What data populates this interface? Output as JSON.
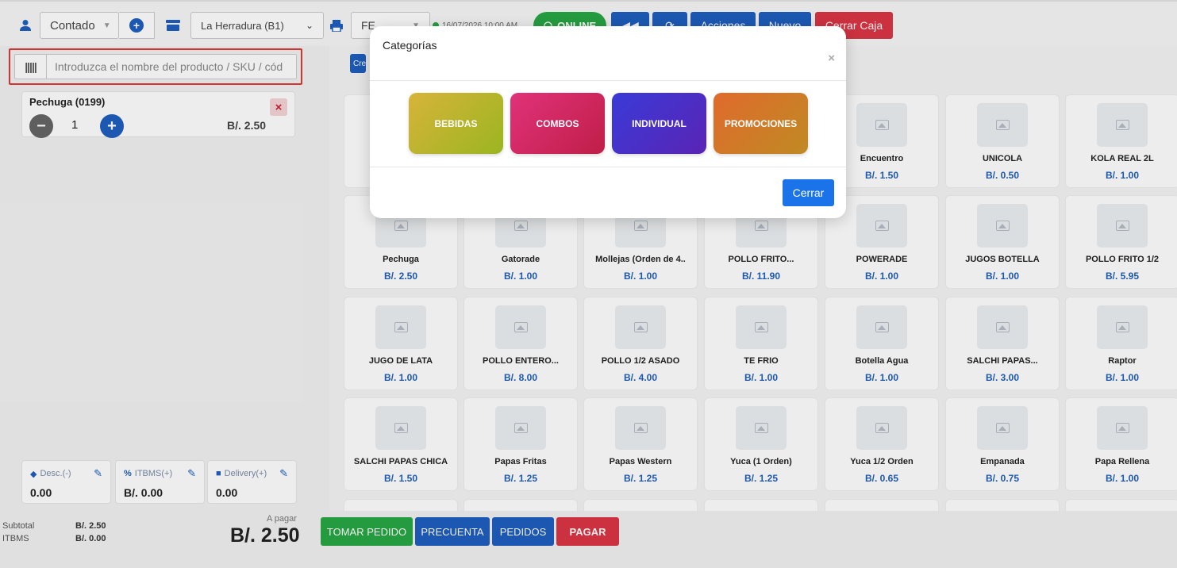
{
  "topbar": {
    "client_select": "Contado",
    "store_select": "La Herradura (B1)",
    "doc_select": "FE",
    "datetime": "16/07/2026 10:00 AM",
    "online": "ONLINE",
    "acciones": "Acciones",
    "nuevo": "Nuevo",
    "cerrar_caja": "Cerrar Caja"
  },
  "search": {
    "placeholder": "Introduzca el nombre del producto / SKU / cód"
  },
  "cart": {
    "items": [
      {
        "name": "Pechuga (0199)",
        "qty": "1",
        "price": "B/. 2.50"
      }
    ]
  },
  "adjustments": {
    "desc_label": "Desc.(-)",
    "desc_value": "0.00",
    "itbms_label": "ITBMS(+)",
    "itbms_value": "B/. 0.00",
    "delivery_label": "Delivery(+)",
    "delivery_value": "0.00"
  },
  "totals": {
    "subtotal_label": "Subtotal",
    "subtotal_value": "B/. 2.50",
    "itbms_label": "ITBMS",
    "itbms_value": "B/. 0.00",
    "apagar_label": "A pagar",
    "apagar_value": "B/. 2.50"
  },
  "bottom": {
    "tomar_pedido": "TOMAR PEDIDO",
    "precuenta": "PRECUENTA",
    "pedidos": "PEDIDOS",
    "pagar": "PAGAR"
  },
  "grid": {
    "categories_btn": "Cre",
    "products": [
      {
        "name": "Encuentro",
        "price": "B/. 1.50"
      },
      {
        "name": "UNICOLA",
        "price": "B/. 0.50"
      },
      {
        "name": "KOLA REAL 2L",
        "price": "B/. 1.00"
      },
      {
        "name": "Pechuga",
        "price": "B/. 2.50"
      },
      {
        "name": "Gatorade",
        "price": "B/. 1.00"
      },
      {
        "name": "Mollejas (Orden de 4..",
        "price": "B/. 1.00"
      },
      {
        "name": "POLLO FRITO...",
        "price": "B/. 11.90"
      },
      {
        "name": "POWERADE",
        "price": "B/. 1.00"
      },
      {
        "name": "JUGOS BOTELLA",
        "price": "B/. 1.00"
      },
      {
        "name": "POLLO FRITO 1/2",
        "price": "B/. 5.95"
      },
      {
        "name": "JUGO DE LATA",
        "price": "B/. 1.00"
      },
      {
        "name": "POLLO ENTERO...",
        "price": "B/. 8.00"
      },
      {
        "name": "POLLO 1/2 ASADO",
        "price": "B/. 4.00"
      },
      {
        "name": "TE FRIO",
        "price": "B/. 1.00"
      },
      {
        "name": "Botella Agua",
        "price": "B/. 1.00"
      },
      {
        "name": "SALCHI PAPAS...",
        "price": "B/. 3.00"
      },
      {
        "name": "Raptor",
        "price": "B/. 1.00"
      },
      {
        "name": "SALCHI PAPAS CHICA",
        "price": "B/. 1.50"
      },
      {
        "name": "Papas Fritas",
        "price": "B/. 1.25"
      },
      {
        "name": "Papas Western",
        "price": "B/. 1.25"
      },
      {
        "name": "Yuca (1 Orden)",
        "price": "B/. 1.25"
      },
      {
        "name": "Yuca 1/2 Orden",
        "price": "B/. 0.65"
      },
      {
        "name": "Empanada",
        "price": "B/. 0.75"
      },
      {
        "name": "Papa Rellena",
        "price": "B/. 1.00"
      }
    ]
  },
  "modal": {
    "title": "Categorías",
    "close": "×",
    "categories": [
      "BEBIDAS",
      "COMBOS",
      "INDIVIDUAL",
      "PROMOCIONES"
    ],
    "cerrar": "Cerrar"
  }
}
